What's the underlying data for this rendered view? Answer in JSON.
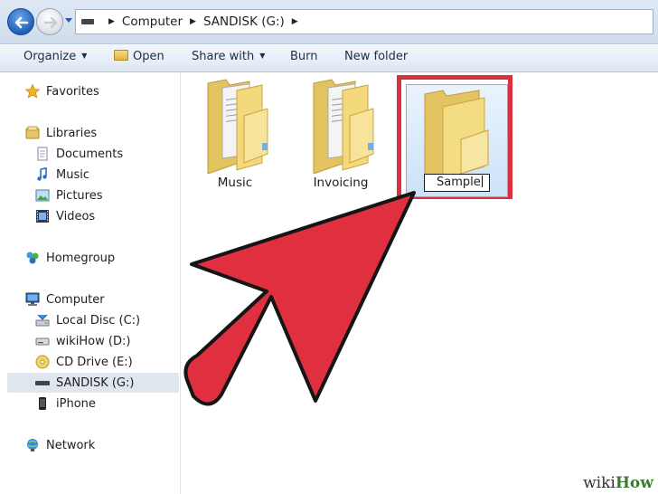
{
  "address_bar": {
    "crumbs": [
      "Computer",
      "SANDISK (G:)"
    ]
  },
  "toolbar": {
    "organize": "Organize",
    "open": "Open",
    "share_with": "Share with",
    "burn": "Burn",
    "new_folder": "New folder"
  },
  "nav": {
    "favorites": "Favorites",
    "libraries": "Libraries",
    "documents": "Documents",
    "music": "Music",
    "pictures": "Pictures",
    "videos": "Videos",
    "homegroup": "Homegroup",
    "computer": "Computer",
    "local_disc": "Local Disc (C:)",
    "wikihow": "wikiHow (D:)",
    "cd_drive": "CD Drive (E:)",
    "sandisk": "SANDISK (G:)",
    "iphone": "iPhone",
    "network": "Network"
  },
  "files": {
    "music": "Music",
    "invoicing": "Invoicing",
    "sample_rename_value": "Sample"
  },
  "colors": {
    "highlight_red": "#d9313f",
    "arrow_red": "#e0303f"
  },
  "watermark": {
    "prefix": "wiki",
    "suffix": "How"
  }
}
